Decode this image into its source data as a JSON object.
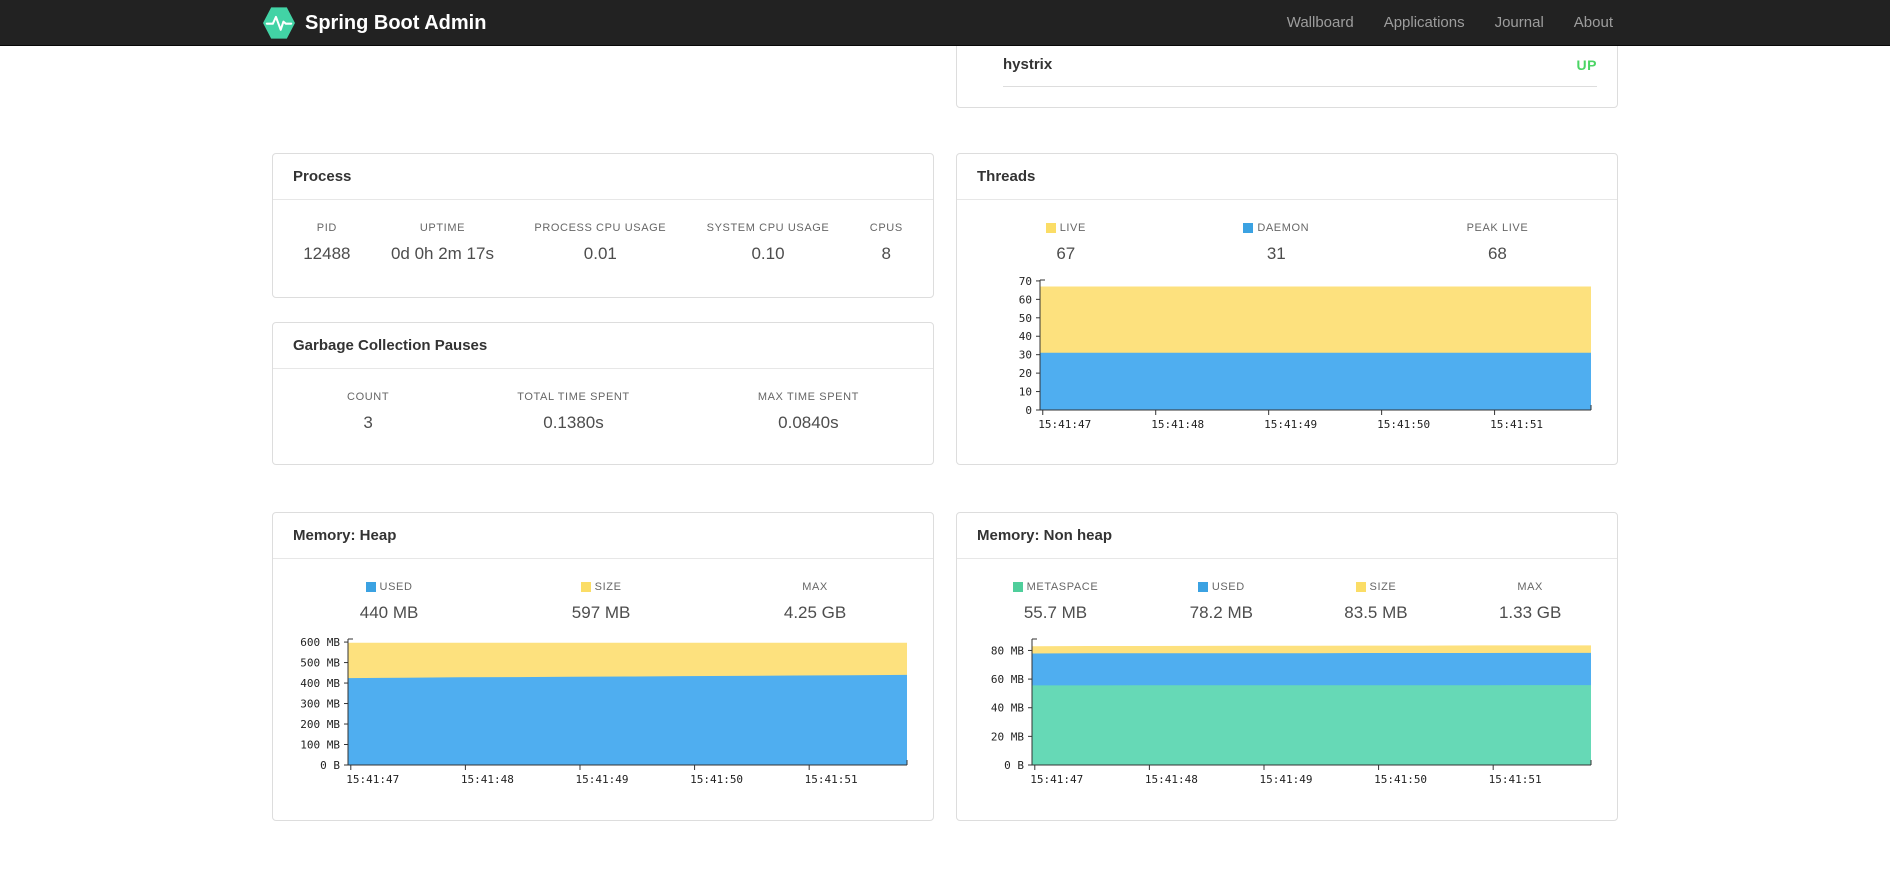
{
  "navbar": {
    "brand": "Spring Boot Admin",
    "links": [
      "Wallboard",
      "Applications",
      "Journal",
      "About"
    ]
  },
  "status_card": {
    "application": "hystrix",
    "status": "UP",
    "status_color": "#4bd565"
  },
  "process": {
    "title": "Process",
    "metrics": [
      {
        "label": "PID",
        "value": "12488"
      },
      {
        "label": "UPTIME",
        "value": "0d 0h 2m 17s"
      },
      {
        "label": "PROCESS CPU USAGE",
        "value": "0.01"
      },
      {
        "label": "SYSTEM CPU USAGE",
        "value": "0.10"
      },
      {
        "label": "CPUS",
        "value": "8"
      }
    ]
  },
  "gc": {
    "title": "Garbage Collection Pauses",
    "metrics": [
      {
        "label": "COUNT",
        "value": "3"
      },
      {
        "label": "TOTAL TIME SPENT",
        "value": "0.1380s"
      },
      {
        "label": "MAX TIME SPENT",
        "value": "0.0840s"
      }
    ]
  },
  "threads": {
    "title": "Threads",
    "legend": [
      {
        "label": "LIVE",
        "value": "67",
        "color": "#fbdd66"
      },
      {
        "label": "DAEMON",
        "value": "31",
        "color": "#3ba2e2"
      },
      {
        "label": "PEAK LIVE",
        "value": "68",
        "color": null
      }
    ]
  },
  "heap": {
    "title": "Memory: Heap",
    "legend": [
      {
        "label": "USED",
        "value": "440 MB",
        "color": "#3ba2e2"
      },
      {
        "label": "SIZE",
        "value": "597 MB",
        "color": "#fbdd66"
      },
      {
        "label": "MAX",
        "value": "4.25 GB",
        "color": null
      }
    ]
  },
  "nonheap": {
    "title": "Memory: Non heap",
    "legend": [
      {
        "label": "METASPACE",
        "value": "55.7 MB",
        "color": "#4fce9b"
      },
      {
        "label": "USED",
        "value": "78.2 MB",
        "color": "#3ba2e2"
      },
      {
        "label": "SIZE",
        "value": "83.5 MB",
        "color": "#fbdd66"
      },
      {
        "label": "MAX",
        "value": "1.33 GB",
        "color": null
      }
    ]
  },
  "chart_data": [
    {
      "id": "threads",
      "type": "area",
      "title": "Threads",
      "legend_position": "top",
      "grid": false,
      "x": [
        "15:41:47",
        "15:41:48",
        "15:41:49",
        "15:41:50",
        "15:41:51"
      ],
      "ylim": [
        0,
        70
      ],
      "ymax": 70.5,
      "yticks": [
        {
          "v": 0,
          "label": "0"
        },
        {
          "v": 10,
          "label": "10"
        },
        {
          "v": 20,
          "label": "20"
        },
        {
          "v": 30,
          "label": "30"
        },
        {
          "v": 40,
          "label": "40"
        },
        {
          "v": 50,
          "label": "50"
        },
        {
          "v": 60,
          "label": "60"
        },
        {
          "v": 70,
          "label": "70"
        }
      ],
      "series": [
        {
          "name": "LIVE",
          "color": "#fde17e",
          "values": [
            67,
            67,
            67,
            67,
            67,
            67,
            67,
            67,
            67,
            67,
            67
          ]
        },
        {
          "name": "DAEMON",
          "color": "#4faef0",
          "values": [
            31,
            31,
            31,
            31,
            31,
            31,
            31,
            31,
            31,
            31,
            31
          ]
        }
      ]
    },
    {
      "id": "heap",
      "type": "area",
      "title": "Memory: Heap",
      "legend_position": "top",
      "grid": false,
      "x": [
        "15:41:47",
        "15:41:48",
        "15:41:49",
        "15:41:50",
        "15:41:51"
      ],
      "ylim": [
        0,
        600
      ],
      "ymax": 615,
      "yticks": [
        {
          "v": 0,
          "label": "0 B"
        },
        {
          "v": 100,
          "label": "100 MB"
        },
        {
          "v": 200,
          "label": "200 MB"
        },
        {
          "v": 300,
          "label": "300 MB"
        },
        {
          "v": 400,
          "label": "400 MB"
        },
        {
          "v": 500,
          "label": "500 MB"
        },
        {
          "v": 600,
          "label": "600 MB"
        }
      ],
      "series": [
        {
          "name": "SIZE",
          "color": "#fde17e",
          "values": [
            597,
            597,
            597,
            597,
            597,
            597,
            597,
            597,
            597,
            597,
            597
          ]
        },
        {
          "name": "USED",
          "color": "#4faef0",
          "values": [
            424,
            426,
            428,
            429,
            431,
            432,
            434,
            435,
            437,
            438,
            440
          ]
        }
      ]
    },
    {
      "id": "nonheap",
      "type": "area",
      "title": "Memory: Non heap",
      "legend_position": "top",
      "grid": false,
      "x": [
        "15:41:47",
        "15:41:48",
        "15:41:49",
        "15:41:50",
        "15:41:51"
      ],
      "ylim": [
        0,
        80
      ],
      "ymax": 88,
      "yticks": [
        {
          "v": 0,
          "label": "0 B"
        },
        {
          "v": 20,
          "label": "20 MB"
        },
        {
          "v": 40,
          "label": "40 MB"
        },
        {
          "v": 60,
          "label": "60 MB"
        },
        {
          "v": 80,
          "label": "80 MB"
        }
      ],
      "series": [
        {
          "name": "SIZE",
          "color": "#fde17e",
          "values": [
            83.0,
            83.1,
            83.1,
            83.2,
            83.3,
            83.3,
            83.4,
            83.4,
            83.5,
            83.5,
            83.5
          ]
        },
        {
          "name": "USED",
          "color": "#4faef0",
          "values": [
            77.9,
            78.0,
            78.0,
            78.1,
            78.1,
            78.1,
            78.2,
            78.2,
            78.2,
            78.3,
            78.3
          ]
        },
        {
          "name": "METASPACE",
          "color": "#66d9b6",
          "values": [
            55.6,
            55.6,
            55.7,
            55.7,
            55.7,
            55.7,
            55.7,
            55.7,
            55.7,
            55.8,
            55.8
          ]
        }
      ]
    }
  ]
}
